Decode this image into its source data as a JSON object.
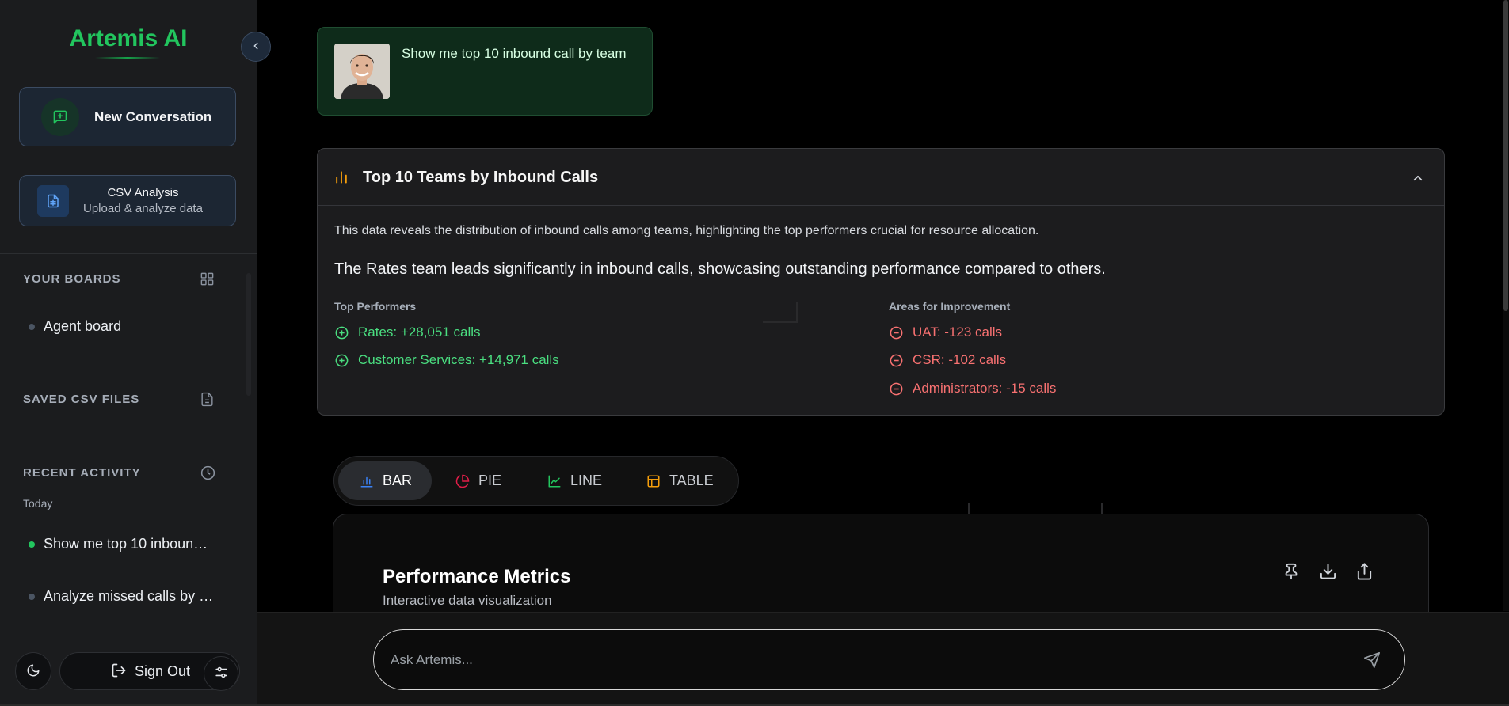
{
  "app": {
    "brand": "Artemis AI"
  },
  "sidebar": {
    "new_conversation": "New Conversation",
    "csv_analysis": {
      "title": "CSV Analysis",
      "subtitle": "Upload & analyze data"
    },
    "boards_heading": "YOUR BOARDS",
    "boards": [
      {
        "label": "Agent board"
      }
    ],
    "saved_csv_heading": "SAVED CSV FILES",
    "recent_heading": "RECENT ACTIVITY",
    "recent_group": "Today",
    "recent": [
      {
        "label": "Show me top 10 inboun…",
        "active": true
      },
      {
        "label": "Analyze missed calls by …",
        "active": false
      }
    ],
    "sign_out": "Sign Out"
  },
  "conversation": {
    "user_message": "Show me top 10 inbound call by team"
  },
  "insight_card": {
    "title": "Top 10 Teams by Inbound Calls",
    "description": "This data reveals the distribution of inbound calls among teams, highlighting the top performers crucial for resource allocation.",
    "highlight": "The Rates team leads significantly in inbound calls, showcasing outstanding performance compared to others.",
    "top_heading": "Top Performers",
    "top": [
      {
        "label": "Rates: +28,051 calls"
      },
      {
        "label": "Customer Services: +14,971 calls"
      }
    ],
    "improve_heading": "Areas for Improvement",
    "improve": [
      {
        "label": "UAT: -123 calls"
      },
      {
        "label": "CSR: -102 calls"
      },
      {
        "label": "Administrators: -15 calls"
      }
    ]
  },
  "view_tabs": [
    {
      "label": "BAR",
      "active": true,
      "color": "#3b82f6"
    },
    {
      "label": "PIE",
      "active": false,
      "color": "#e11d48"
    },
    {
      "label": "LINE",
      "active": false,
      "color": "#22c55e"
    },
    {
      "label": "TABLE",
      "active": false,
      "color": "#f59e0b"
    }
  ],
  "viz_panel": {
    "title": "Performance Metrics",
    "subtitle": "Interactive data visualization"
  },
  "chat_input": {
    "placeholder": "Ask Artemis..."
  },
  "colors": {
    "accent": "#22c55e",
    "positive": "#4ade80",
    "negative": "#f87171",
    "chart_icon": "#f59e0b"
  }
}
